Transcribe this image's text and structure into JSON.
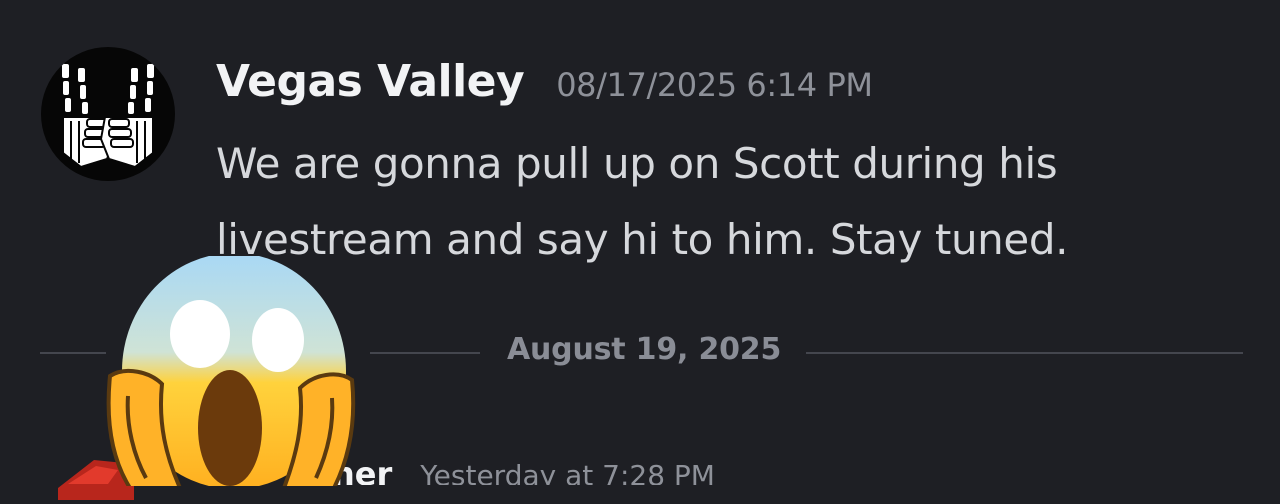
{
  "message": {
    "author": "Vegas Valley",
    "timestamp": "08/17/2025 6:14 PM",
    "text": "We are gonna pull up on Scott during his livestream and say hi to him. Stay tuned.",
    "avatar_icon": "skeleton-hands-w-icon"
  },
  "date_divider": {
    "label": "August 19, 2025"
  },
  "next_message": {
    "author_partial": "…ner",
    "timestamp_partial": "Yesterday at 7:28 PM"
  },
  "overlay": {
    "emoji": "screaming-face-emoji"
  },
  "colors": {
    "background": "#1e1f24",
    "author": "#f2f3f5",
    "timestamp": "#8e9199",
    "message_text": "#d6d8dc",
    "divider": "#44464e"
  }
}
